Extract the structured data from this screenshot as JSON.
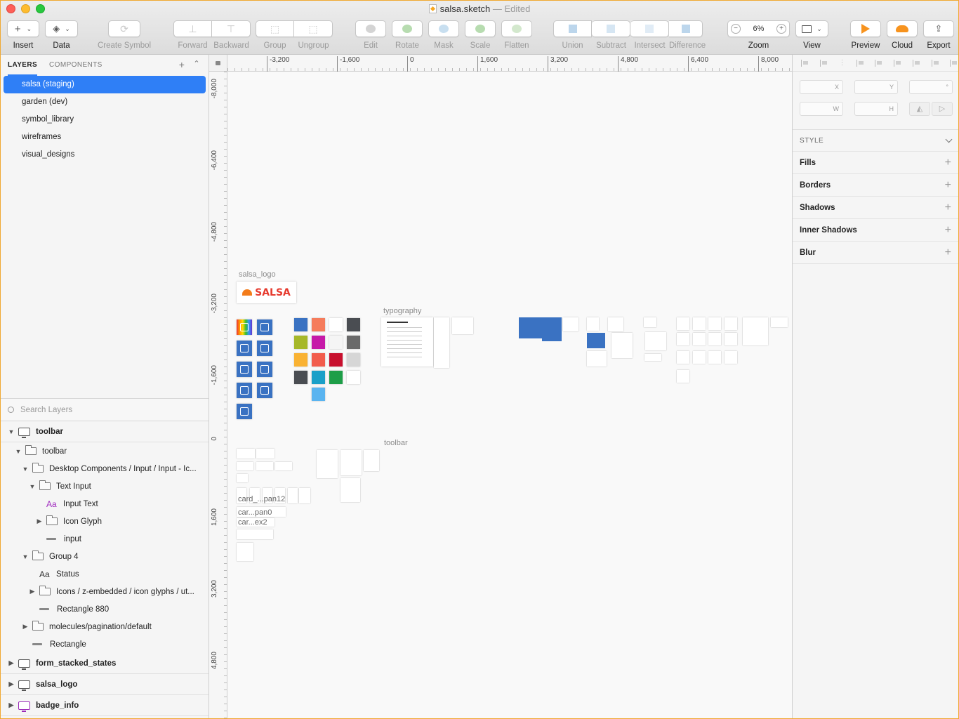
{
  "window": {
    "doc_name": "salsa.sketch",
    "doc_status": "— Edited"
  },
  "toolbar": {
    "insert": "Insert",
    "data": "Data",
    "create_symbol": "Create Symbol",
    "forward": "Forward",
    "backward": "Backward",
    "group": "Group",
    "ungroup": "Ungroup",
    "edit": "Edit",
    "rotate": "Rotate",
    "mask": "Mask",
    "scale": "Scale",
    "flatten": "Flatten",
    "union": "Union",
    "subtract": "Subtract",
    "intersect": "Intersect",
    "difference": "Difference",
    "zoom": "Zoom",
    "zoom_value": "6%",
    "zoom_minus": "−",
    "zoom_plus": "+",
    "view": "View",
    "preview": "Preview",
    "cloud": "Cloud",
    "export": "Export"
  },
  "left_panel": {
    "tab_layers": "LAYERS",
    "tab_components": "COMPONENTS",
    "pages": [
      "salsa (staging)",
      "garden (dev)",
      "symbol_library",
      "wireframes",
      "visual_designs"
    ],
    "selected_page": "salsa (staging)",
    "search_placeholder": "Search Layers",
    "layers": [
      {
        "name": "toolbar",
        "type": "artboard",
        "depth": 0,
        "disclosure": "open"
      },
      {
        "name": "toolbar",
        "type": "folder",
        "depth": 1,
        "disclosure": "open"
      },
      {
        "name": "Desktop Components / Input / Input - Ic...",
        "type": "folder",
        "depth": 2,
        "disclosure": "open"
      },
      {
        "name": "Text Input",
        "type": "folder",
        "depth": 3,
        "disclosure": "open"
      },
      {
        "name": "Input Text",
        "type": "text-purple",
        "depth": 4,
        "disclosure": "none"
      },
      {
        "name": "Icon Glyph",
        "type": "folder",
        "depth": 4,
        "disclosure": "closed"
      },
      {
        "name": "input",
        "type": "rect",
        "depth": 4,
        "disclosure": "none"
      },
      {
        "name": "Group 4",
        "type": "folder",
        "depth": 2,
        "disclosure": "open"
      },
      {
        "name": "Status",
        "type": "text",
        "depth": 3,
        "disclosure": "none"
      },
      {
        "name": "Icons / z-embedded / icon glyphs / ut...",
        "type": "folder",
        "depth": 3,
        "disclosure": "closed"
      },
      {
        "name": "Rectangle 880",
        "type": "rect",
        "depth": 3,
        "disclosure": "none"
      },
      {
        "name": "molecules/pagination/default",
        "type": "folder",
        "depth": 2,
        "disclosure": "closed"
      },
      {
        "name": "Rectangle",
        "type": "rect",
        "depth": 2,
        "disclosure": "none"
      },
      {
        "name": "form_stacked_states",
        "type": "artboard",
        "depth": 0,
        "disclosure": "closed"
      },
      {
        "name": "salsa_logo",
        "type": "artboard",
        "depth": 0,
        "disclosure": "closed"
      },
      {
        "name": "badge_info",
        "type": "artboard-purple",
        "depth": 0,
        "disclosure": "closed"
      }
    ]
  },
  "canvas": {
    "ruler_x": [
      "-3,200",
      "-1,600",
      "0",
      "1,600",
      "3,200",
      "4,800",
      "6,400",
      "8,000"
    ],
    "ruler_y": [
      "-8,000",
      "-6,400",
      "-4,800",
      "-3,200",
      "-1,600",
      "0",
      "1,600",
      "3,200",
      "4,800"
    ],
    "artboard_labels": {
      "logo": "salsa_logo",
      "typography": "typography",
      "toolbar": "toolbar"
    },
    "logo_text": "SALSA",
    "small_labels": [
      "card_...pan12",
      "car...pan0",
      "car...ex2"
    ],
    "colors": {
      "blue": "#3a72c2",
      "swatches": [
        "#3a72c2",
        "#f57c5c",
        "#ffffff",
        "#4a4d52",
        "#a6b82a",
        "#c61aa8",
        "#f5f5f5",
        "#6a6a6a",
        "#f9b233",
        "#f25c4c",
        "#c8102e",
        "#d6d6d6",
        "#4a4d52",
        "#1aa0c8",
        "#1e9e48",
        "#ffffff",
        "#5ab4f0"
      ]
    }
  },
  "inspector": {
    "x_label": "X",
    "y_label": "Y",
    "rot_label": "°",
    "w_label": "W",
    "h_label": "H",
    "style": "STYLE",
    "sections": [
      "Fills",
      "Borders",
      "Shadows",
      "Inner Shadows",
      "Blur"
    ]
  },
  "accent": "#2f7ff6"
}
